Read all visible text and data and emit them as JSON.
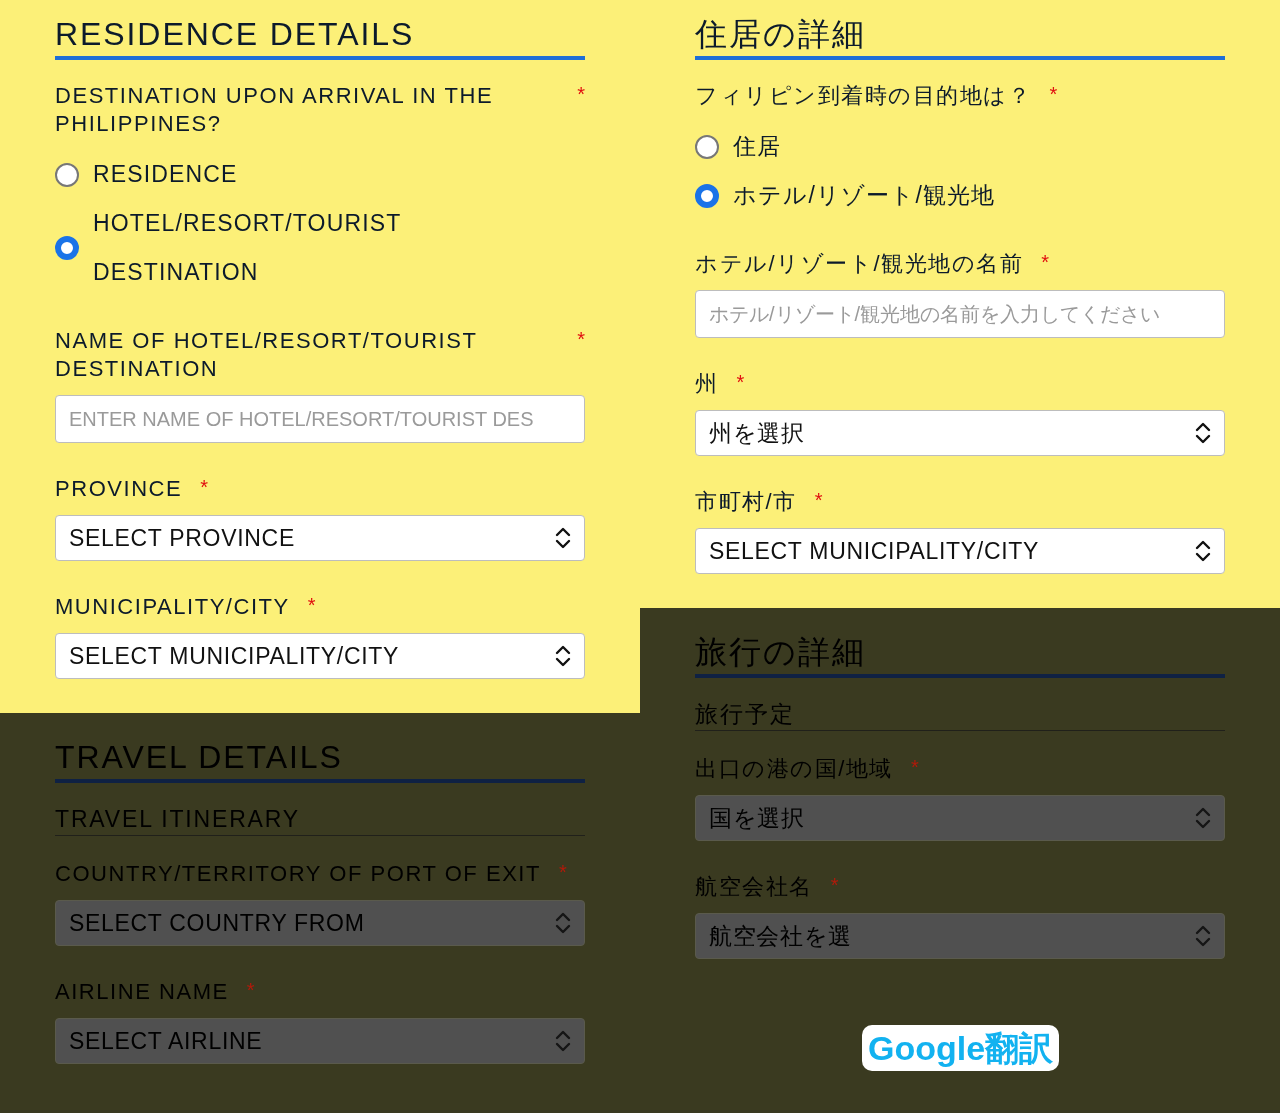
{
  "columns": [
    {
      "sections": [
        {
          "dimmed": false,
          "heading": "RESIDENCE DETAILS",
          "fields": [
            {
              "kind": "radio_group",
              "label": "DESTINATION UPON ARRIVAL IN THE PHILIPPINES?",
              "required": "*",
              "options": [
                {
                  "label": "RESIDENCE",
                  "selected": false
                },
                {
                  "label": "HOTEL/RESORT/TOURIST DESTINATION",
                  "selected": true
                }
              ]
            },
            {
              "kind": "text",
              "label": "NAME OF HOTEL/RESORT/TOURIST DESTINATION",
              "required": "*",
              "placeholder": "ENTER NAME OF HOTEL/RESORT/TOURIST DES"
            },
            {
              "kind": "select",
              "label": "PROVINCE",
              "required": "*",
              "value": "SELECT PROVINCE"
            },
            {
              "kind": "select",
              "label": "MUNICIPALITY/CITY",
              "required": "*",
              "value": "SELECT MUNICIPALITY/CITY"
            }
          ]
        },
        {
          "dimmed": true,
          "heading": "TRAVEL DETAILS",
          "fields": [
            {
              "kind": "subheading",
              "label": "TRAVEL ITINERARY"
            },
            {
              "kind": "select",
              "label": "COUNTRY/TERRITORY OF PORT OF EXIT",
              "required": "*",
              "value": "SELECT COUNTRY FROM"
            },
            {
              "kind": "select",
              "label": "AIRLINE NAME",
              "required": "*",
              "value": "SELECT AIRLINE"
            }
          ]
        }
      ]
    },
    {
      "sections": [
        {
          "dimmed": false,
          "heading": "住居の詳細",
          "fields": [
            {
              "kind": "radio_group",
              "label": "フィリピン到着時の目的地は？",
              "required": "*",
              "options": [
                {
                  "label": "住居",
                  "selected": false
                },
                {
                  "label": "ホテル/リゾート/観光地",
                  "selected": true
                }
              ]
            },
            {
              "kind": "text",
              "label": "ホテル/リゾート/観光地の名前",
              "required": "*",
              "placeholder": "ホテル/リゾート/観光地の名前を入力してください"
            },
            {
              "kind": "select",
              "label": "州",
              "required": "*",
              "value": "州を選択"
            },
            {
              "kind": "select",
              "label": "市町村/市",
              "required": "*",
              "value": "SELECT MUNICIPALITY/CITY"
            }
          ]
        },
        {
          "dimmed": true,
          "heading": "旅行の詳細",
          "fields": [
            {
              "kind": "subheading",
              "label": "旅行予定"
            },
            {
              "kind": "select",
              "label": "出口の港の国/地域",
              "required": "*",
              "value": "国を選択"
            },
            {
              "kind": "select",
              "label": "航空会社名",
              "required": "*",
              "value": "航空会社を選"
            }
          ]
        }
      ]
    }
  ],
  "overlay_label": "Google翻訳"
}
